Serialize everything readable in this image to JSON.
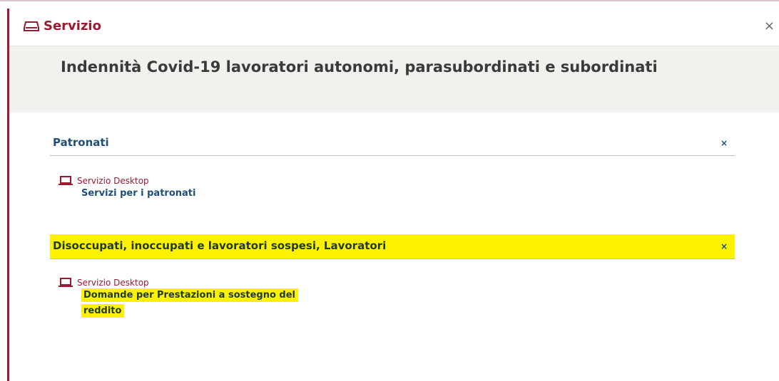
{
  "header": {
    "title": "Servizio",
    "close_symbol": "×"
  },
  "service": {
    "title": "Indennità Covid-19 lavoratori autonomi, parasubordinati e subordinati"
  },
  "sections": [
    {
      "label": "Patronati",
      "close_symbol": "×",
      "items": [
        {
          "type": "Servizio Desktop",
          "link": "Servizi per i patronati"
        }
      ]
    },
    {
      "label": "Disoccupati, inoccupati e lavoratori sospesi, Lavoratori",
      "close_symbol": "×",
      "highlight_color": "#fff200",
      "items": [
        {
          "type": "Servizio Desktop",
          "link_line1": "Domande per Prestazioni a sostegno del",
          "link_line2": "reddito"
        }
      ]
    }
  ],
  "colors": {
    "accent": "#9b1b32",
    "link": "#1f4e79",
    "highlight": "#fff200"
  }
}
